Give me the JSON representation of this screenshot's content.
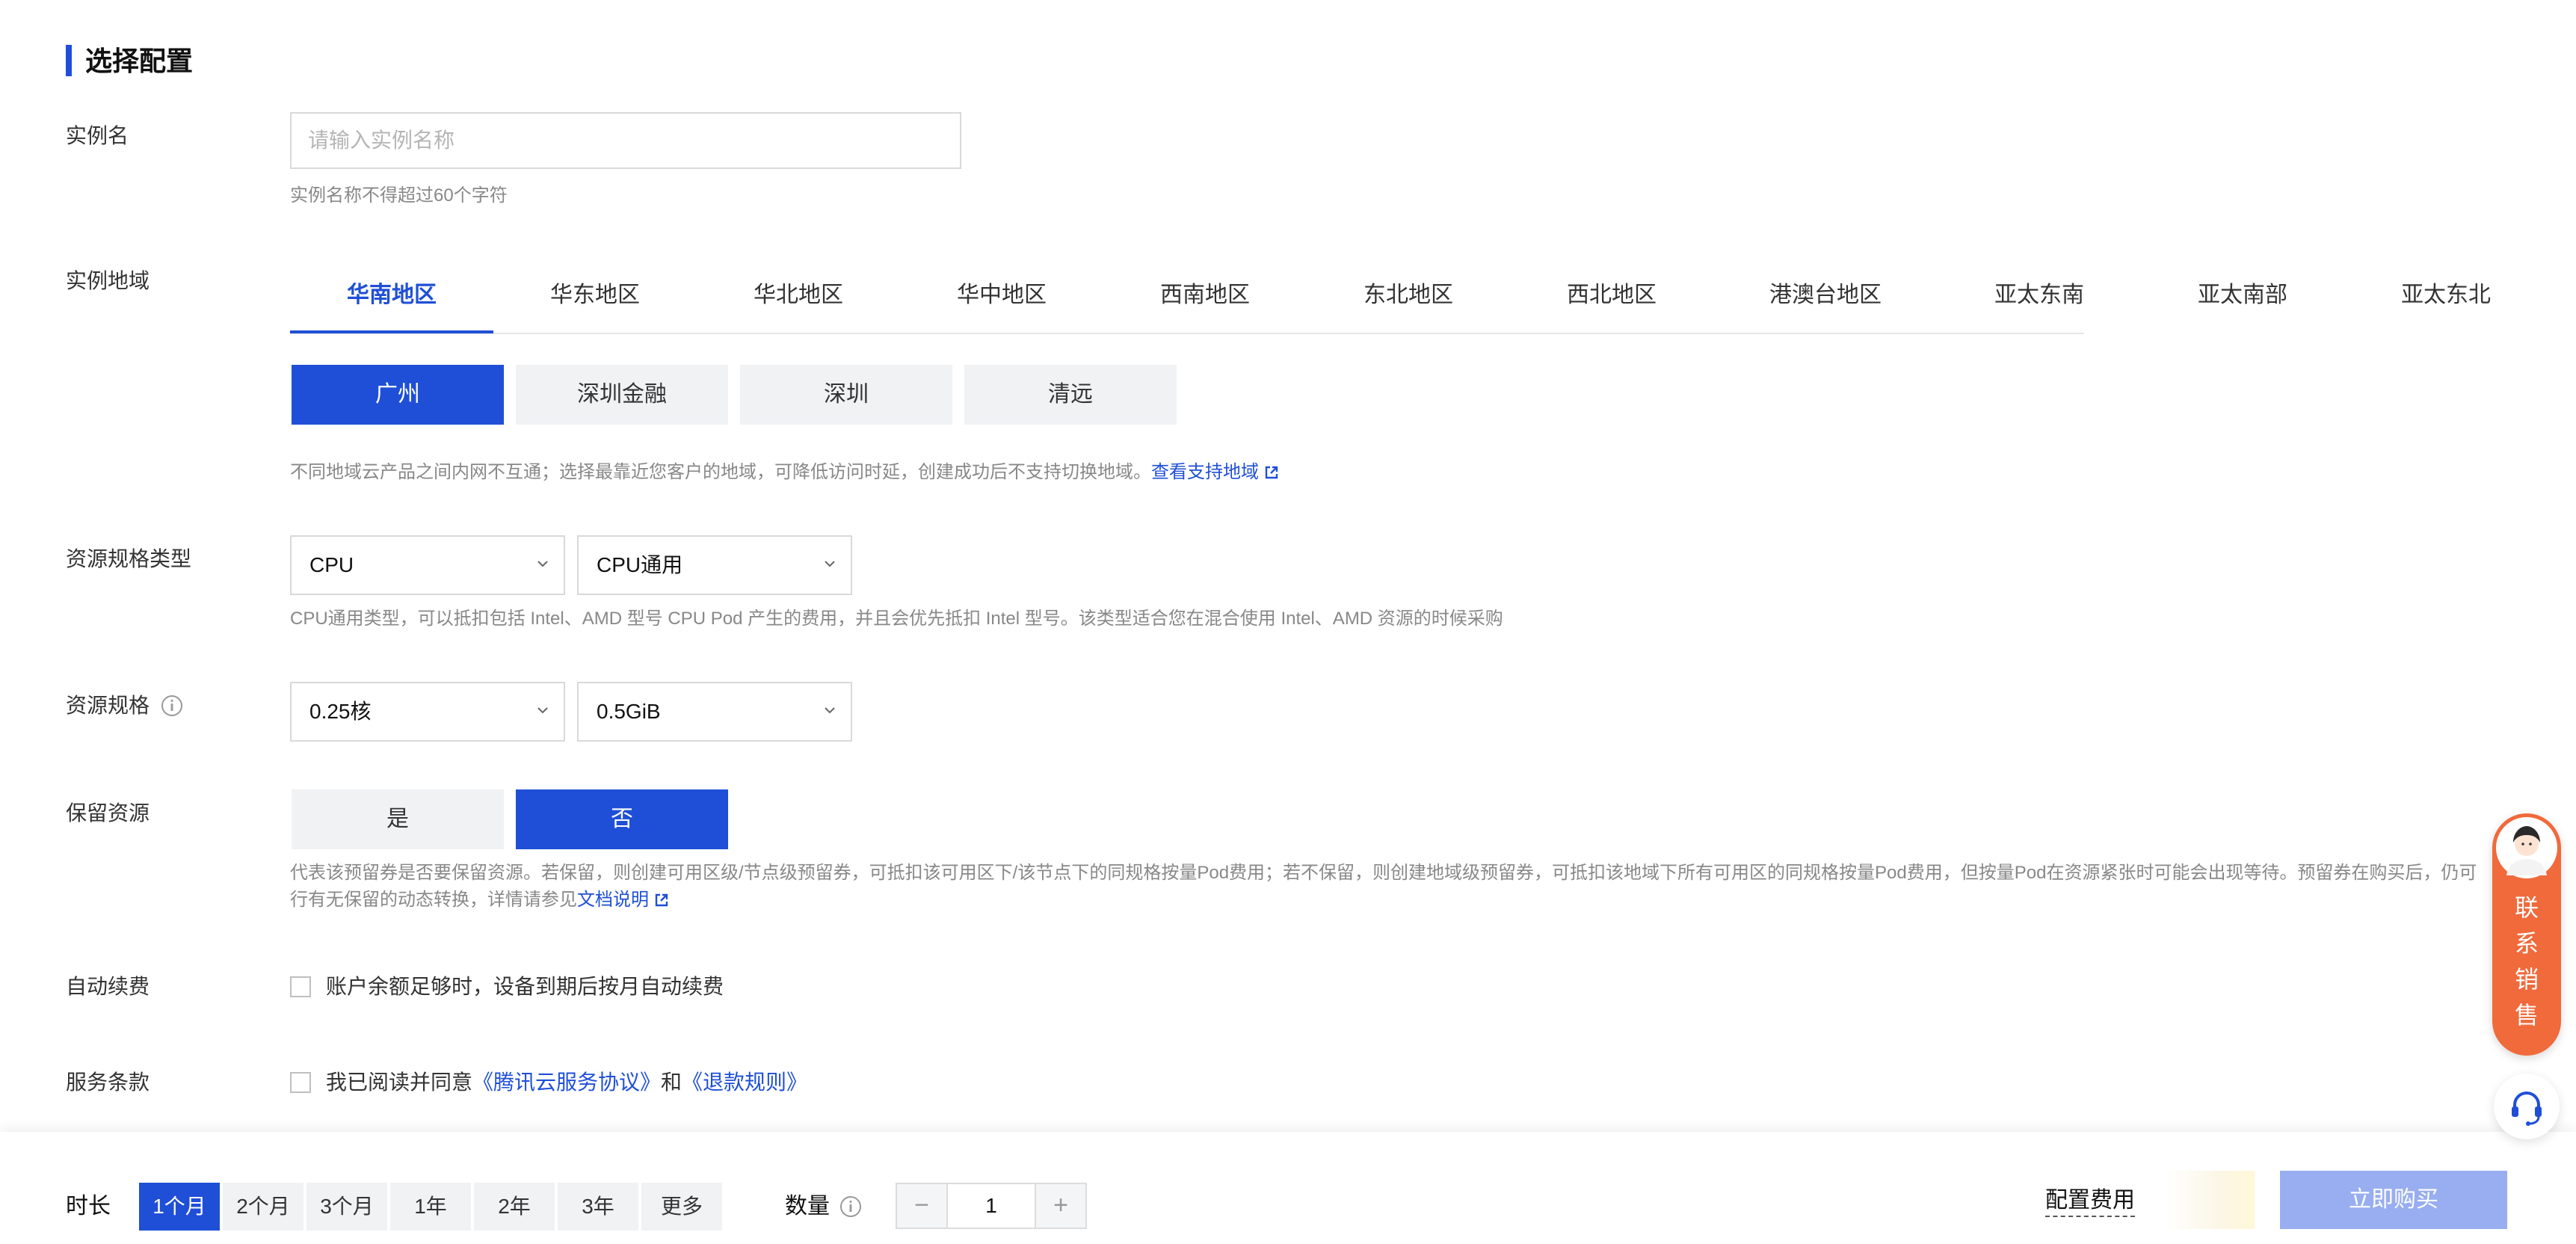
{
  "section_title": "选择配置",
  "instance_name": {
    "label": "实例名",
    "placeholder": "请输入实例名称",
    "value": "",
    "hint": "实例名称不得超过60个字符"
  },
  "region": {
    "label": "实例地域",
    "tabs": [
      "华南地区",
      "华东地区",
      "华北地区",
      "华中地区",
      "西南地区",
      "东北地区",
      "西北地区",
      "港澳台地区",
      "亚太东南",
      "亚太南部",
      "亚太东北"
    ],
    "active_tab": "华南地区",
    "cities": [
      "广州",
      "深圳金融",
      "深圳",
      "清远"
    ],
    "active_city": "广州",
    "hint": "不同地域云产品之间内网不互通；选择最靠近您客户的地域，可降低访问时延，创建成功后不支持切换地域。",
    "hint_link": "查看支持地域"
  },
  "resource_type": {
    "label": "资源规格类型",
    "select1": "CPU",
    "select2": "CPU通用",
    "hint": "CPU通用类型，可以抵扣包括 Intel、AMD 型号 CPU Pod 产生的费用，并且会优先抵扣 Intel 型号。该类型适合您在混合使用 Intel、AMD 资源的时候采购"
  },
  "resource_spec": {
    "label": "资源规格",
    "select1": "0.25核",
    "select2": "0.5GiB"
  },
  "reserve": {
    "label": "保留资源",
    "options": [
      "是",
      "否"
    ],
    "active": "否",
    "hint_line1": "代表该预留券是否要保留资源。若保留，则创建可用区级/节点级预留券，可抵扣该可用区下/该节点下的同规格按量Pod费用；若不保留，则创建地域级预留券，可抵扣该地域下所有可用区的同规格按量Pod费用，但按量Pod在资源紧张时可能会出现等待。预留券在购买后，仍可",
    "hint_line2": "行有无保留的动态转换，详情请参见",
    "hint_link": "文档说明"
  },
  "auto_renew": {
    "label": "自动续费",
    "text": "账户余额足够时，设备到期后按月自动续费"
  },
  "terms": {
    "label": "服务条款",
    "prefix": "我已阅读并同意",
    "link1": "《腾讯云服务协议》",
    "mid": "和",
    "link2": "《退款规则》"
  },
  "footer": {
    "duration_label": "时长",
    "durations": [
      "1个月",
      "2个月",
      "3个月",
      "1年",
      "2年",
      "3年",
      "更多"
    ],
    "active_duration": "1个月",
    "quantity_label": "数量",
    "quantity": "1",
    "minus": "−",
    "plus": "+",
    "fee_label": "配置费用",
    "buy_button": "立即购买"
  },
  "float": {
    "sales_text": "联系销售"
  },
  "colors": {
    "accent": "#1f4fd7",
    "buy_disabled": "#98aef0",
    "float_orange": "#f06a3b"
  }
}
